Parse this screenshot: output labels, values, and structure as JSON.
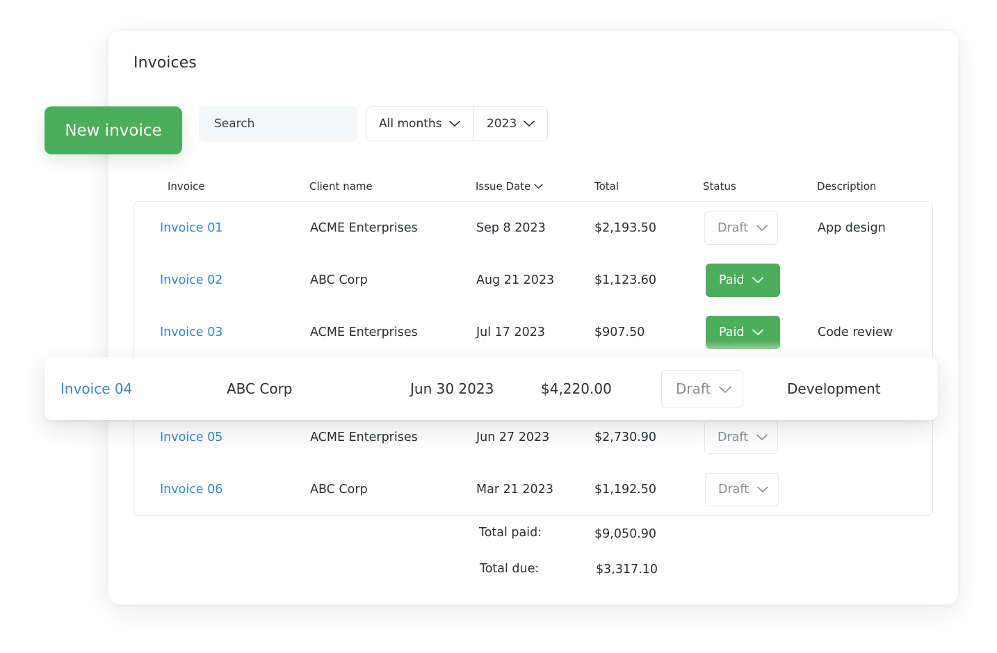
{
  "header": {
    "title": "Invoices"
  },
  "toolbar": {
    "new_invoice_label": "New invoice",
    "search_placeholder": "Search",
    "months_filter": "All months",
    "year_filter": "2023"
  },
  "table": {
    "columns": {
      "invoice": "Invoice",
      "client": "Client name",
      "issue_date": "Issue Date",
      "total": "Total",
      "status": "Status",
      "description": "Description"
    },
    "rows": [
      {
        "invoice": "Invoice 01",
        "client": "ACME Enterprises",
        "date": "Sep 8 2023",
        "total": "$2,193.50",
        "status": "Draft",
        "description": "App design"
      },
      {
        "invoice": "Invoice 02",
        "client": "ABC Corp",
        "date": "Aug 21 2023",
        "total": "$1,123.60",
        "status": "Paid",
        "description": ""
      },
      {
        "invoice": "Invoice 03",
        "client": "ACME Enterprises",
        "date": "Jul 17 2023",
        "total": "$907.50",
        "status": "Paid",
        "description": "Code review"
      },
      {
        "invoice": "Invoice 04",
        "client": "ABC Corp",
        "date": "Jun 30 2023",
        "total": "$4,220.00",
        "status": "Draft",
        "description": "Development"
      },
      {
        "invoice": "Invoice 05",
        "client": "ACME Enterprises",
        "date": "Jun 27 2023",
        "total": "$2,730.90",
        "status": "Draft",
        "description": ""
      },
      {
        "invoice": "Invoice 06",
        "client": "ABC Corp",
        "date": "Mar 21 2023",
        "total": "$1,192.50",
        "status": "Draft",
        "description": ""
      }
    ]
  },
  "totals": {
    "paid_label": "Total paid:",
    "paid_value": "$9,050.90",
    "due_label": "Total due:",
    "due_value": "$3,317.10"
  },
  "colors": {
    "accent_green": "#4cae5a",
    "link_blue": "#3a86d4"
  }
}
